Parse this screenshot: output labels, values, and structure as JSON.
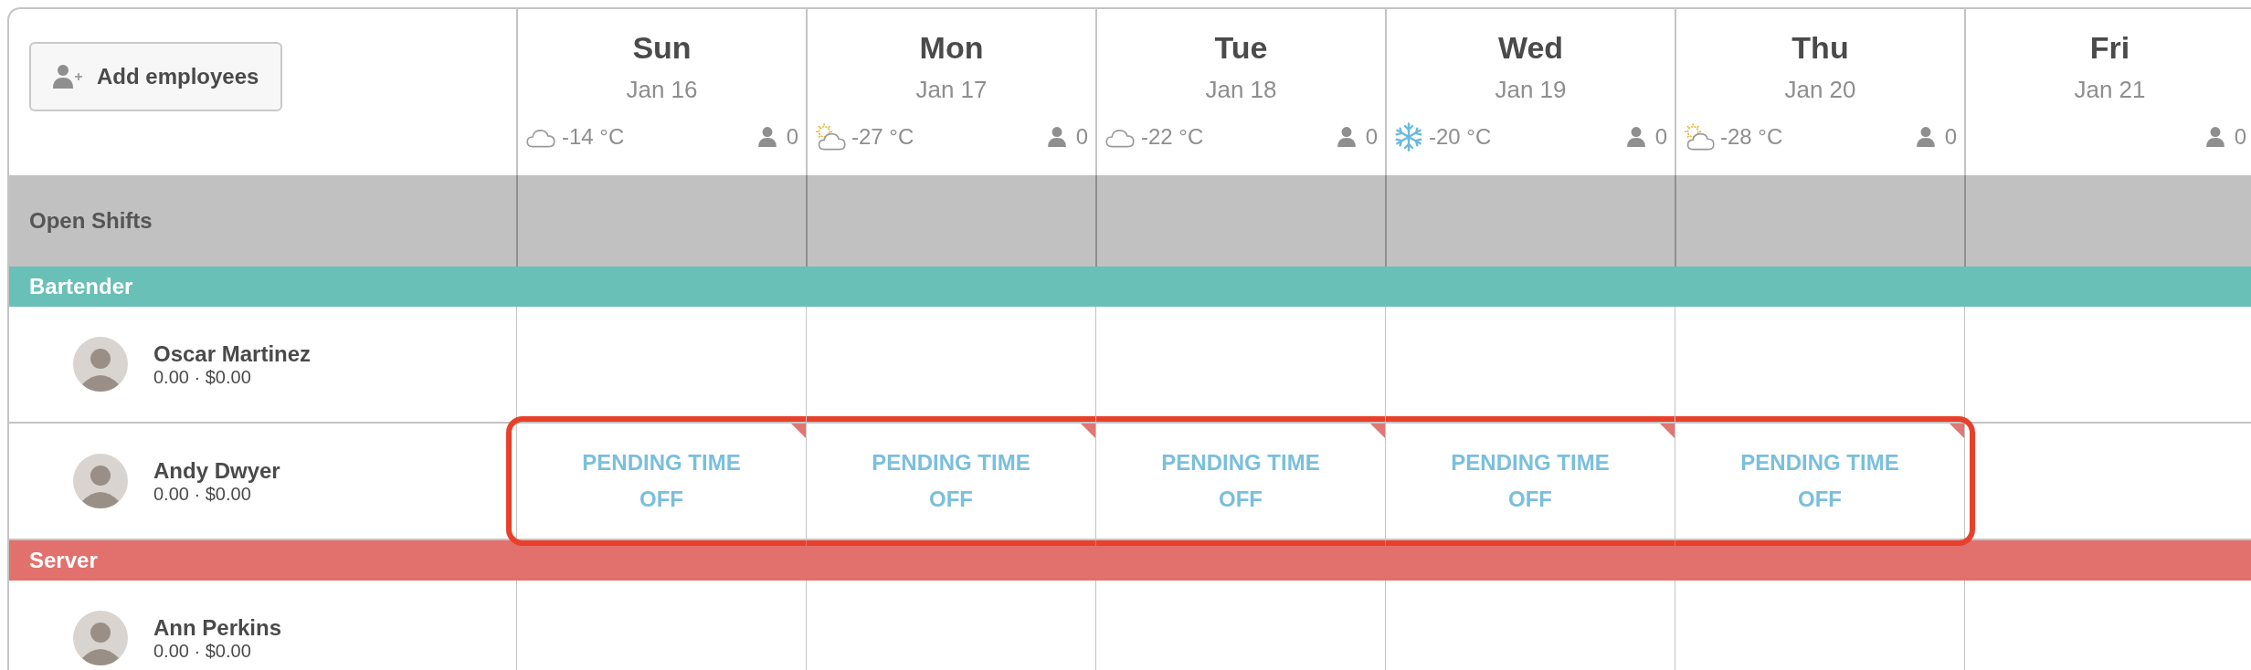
{
  "add_button": {
    "label": "Add employees"
  },
  "days": [
    {
      "day": "Sun",
      "date": "Jan 16",
      "weather": {
        "kind": "cloud",
        "temp": "-14 °C"
      },
      "staff_count": "0"
    },
    {
      "day": "Mon",
      "date": "Jan 17",
      "weather": {
        "kind": "partly-sunny",
        "temp": "-27 °C"
      },
      "staff_count": "0"
    },
    {
      "day": "Tue",
      "date": "Jan 18",
      "weather": {
        "kind": "cloud",
        "temp": "-22 °C"
      },
      "staff_count": "0"
    },
    {
      "day": "Wed",
      "date": "Jan 19",
      "weather": {
        "kind": "snow",
        "temp": "-20 °C"
      },
      "staff_count": "0"
    },
    {
      "day": "Thu",
      "date": "Jan 20",
      "weather": {
        "kind": "partly-sunny",
        "temp": "-28 °C"
      },
      "staff_count": "0"
    },
    {
      "day": "Fri",
      "date": "Jan 21",
      "staff_count": "0"
    }
  ],
  "open_shifts": {
    "label": "Open Shifts"
  },
  "groups": [
    {
      "name": "Bartender",
      "color": "#69c0b7",
      "employees": [
        {
          "name": "Oscar Martinez",
          "stats": "0.00 · $0.00",
          "shifts": [
            {
              "kind": "empty"
            },
            {
              "kind": "empty"
            },
            {
              "kind": "empty"
            },
            {
              "kind": "empty"
            },
            {
              "kind": "empty"
            },
            {
              "kind": "empty"
            }
          ]
        },
        {
          "name": "Andy Dwyer",
          "stats": "0.00 · $0.00",
          "shifts": [
            {
              "kind": "pending",
              "label": "PENDING TIME OFF",
              "highlighted": true
            },
            {
              "kind": "pending",
              "label": "PENDING TIME OFF",
              "highlighted": true
            },
            {
              "kind": "pending",
              "label": "PENDING TIME OFF",
              "highlighted": true
            },
            {
              "kind": "pending",
              "label": "PENDING TIME OFF",
              "highlighted": true
            },
            {
              "kind": "pending",
              "label": "PENDING TIME OFF",
              "highlighted": true
            },
            {
              "kind": "empty"
            }
          ]
        }
      ]
    },
    {
      "name": "Server",
      "color": "#e2706d",
      "employees": [
        {
          "name": "Ann Perkins",
          "stats": "0.00 · $0.00",
          "shifts": [
            {
              "kind": "empty"
            },
            {
              "kind": "empty"
            },
            {
              "kind": "empty"
            },
            {
              "kind": "empty"
            },
            {
              "kind": "empty"
            },
            {
              "kind": "empty"
            }
          ]
        }
      ]
    }
  ]
}
